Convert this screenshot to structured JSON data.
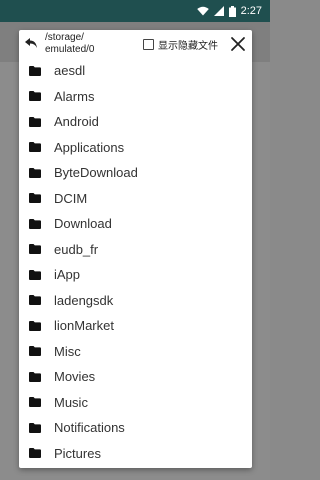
{
  "status_bar": {
    "time": "2:27",
    "icons": [
      "wifi-icon",
      "signal-icon",
      "battery-icon"
    ]
  },
  "dialog": {
    "path": "/storage/\nemulated/0",
    "show_hidden_label": "显示隐藏文件",
    "show_hidden_checked": false
  },
  "folders": [
    "aesdl",
    "Alarms",
    "Android",
    "Applications",
    "ByteDownload",
    "DCIM",
    "Download",
    "eudb_fr",
    "iApp",
    "ladengsdk",
    "lionMarket",
    "Misc",
    "Movies",
    "Music",
    "Notifications",
    "Pictures"
  ]
}
